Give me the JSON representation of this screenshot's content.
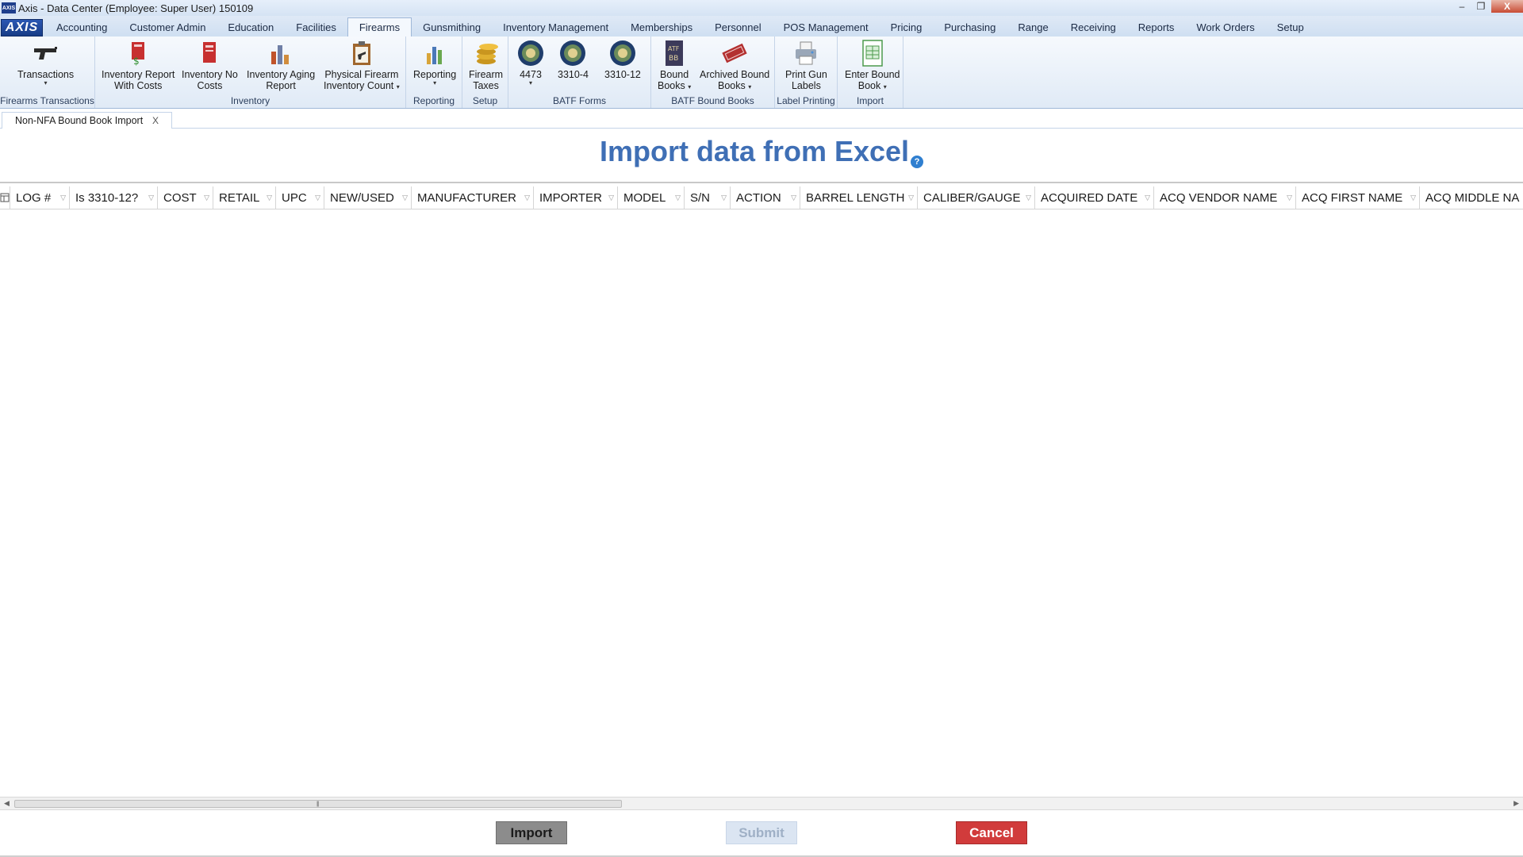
{
  "window": {
    "title": "Axis - Data Center  (Employee: Super User) 150109",
    "app_icon_text": "AXIS",
    "minimize": "–",
    "maximize": "❐",
    "close": "X"
  },
  "ribbon_tabs": {
    "logo": "AXIS",
    "items": [
      {
        "label": "Accounting"
      },
      {
        "label": "Customer Admin"
      },
      {
        "label": "Education"
      },
      {
        "label": "Facilities"
      },
      {
        "label": "Firearms"
      },
      {
        "label": "Gunsmithing"
      },
      {
        "label": "Inventory Management"
      },
      {
        "label": "Memberships"
      },
      {
        "label": "Personnel"
      },
      {
        "label": "POS Management"
      },
      {
        "label": "Pricing"
      },
      {
        "label": "Purchasing"
      },
      {
        "label": "Range"
      },
      {
        "label": "Receiving"
      },
      {
        "label": "Reports"
      },
      {
        "label": "Work Orders"
      },
      {
        "label": "Setup"
      }
    ],
    "active": "Firearms"
  },
  "ribbon": {
    "groups": {
      "firearms_transactions": "Firearms Transactions",
      "inventory": "Inventory",
      "reporting": "Reporting",
      "setup": "Setup",
      "batf_forms": "BATF Forms",
      "batf_bound_books": "BATF Bound Books",
      "label_printing": "Label Printing",
      "import": "Import"
    },
    "buttons": {
      "transactions": "Transactions",
      "inv_report_costs_1": "Inventory Report",
      "inv_report_costs_2": "With Costs",
      "inv_no_costs_1": "Inventory No",
      "inv_no_costs_2": "Costs",
      "inv_aging_1": "Inventory Aging",
      "inv_aging_2": "Report",
      "physical_count_1": "Physical Firearm",
      "physical_count_2": "Inventory Count",
      "reporting": "Reporting",
      "firearm_taxes_1": "Firearm",
      "firearm_taxes_2": "Taxes",
      "form_4473": "4473",
      "form_3310_4": "3310-4",
      "form_3310_12": "3310-12",
      "bound_books_1": "Bound",
      "bound_books_2": "Books",
      "archived_1": "Archived Bound",
      "archived_2": "Books",
      "print_labels_1": "Print Gun",
      "print_labels_2": "Labels",
      "enter_bound_1": "Enter Bound",
      "enter_bound_2": "Book"
    }
  },
  "doc_tab": {
    "label": "Non-NFA Bound Book Import",
    "close": "X"
  },
  "main": {
    "heading": "Import data from Excel",
    "help": "?"
  },
  "grid": {
    "columns": [
      {
        "label": "LOG #"
      },
      {
        "label": "Is 3310-12?"
      },
      {
        "label": "COST"
      },
      {
        "label": "RETAIL"
      },
      {
        "label": "UPC"
      },
      {
        "label": "NEW/USED"
      },
      {
        "label": "MANUFACTURER"
      },
      {
        "label": "IMPORTER"
      },
      {
        "label": "MODEL"
      },
      {
        "label": "S/N"
      },
      {
        "label": "ACTION"
      },
      {
        "label": "BARREL LENGTH"
      },
      {
        "label": "CALIBER/GAUGE"
      },
      {
        "label": "ACQUIRED DATE"
      },
      {
        "label": "ACQ VENDOR NAME"
      },
      {
        "label": "ACQ FIRST NAME"
      },
      {
        "label": "ACQ MIDDLE NA"
      }
    ]
  },
  "actions": {
    "import": "Import",
    "submit": "Submit",
    "cancel": "Cancel"
  },
  "colors": {
    "heading": "#3f6fb5",
    "cancel": "#d13b3b",
    "import": "#8c8c8c",
    "submit_disabled": "#dbe5f2"
  }
}
